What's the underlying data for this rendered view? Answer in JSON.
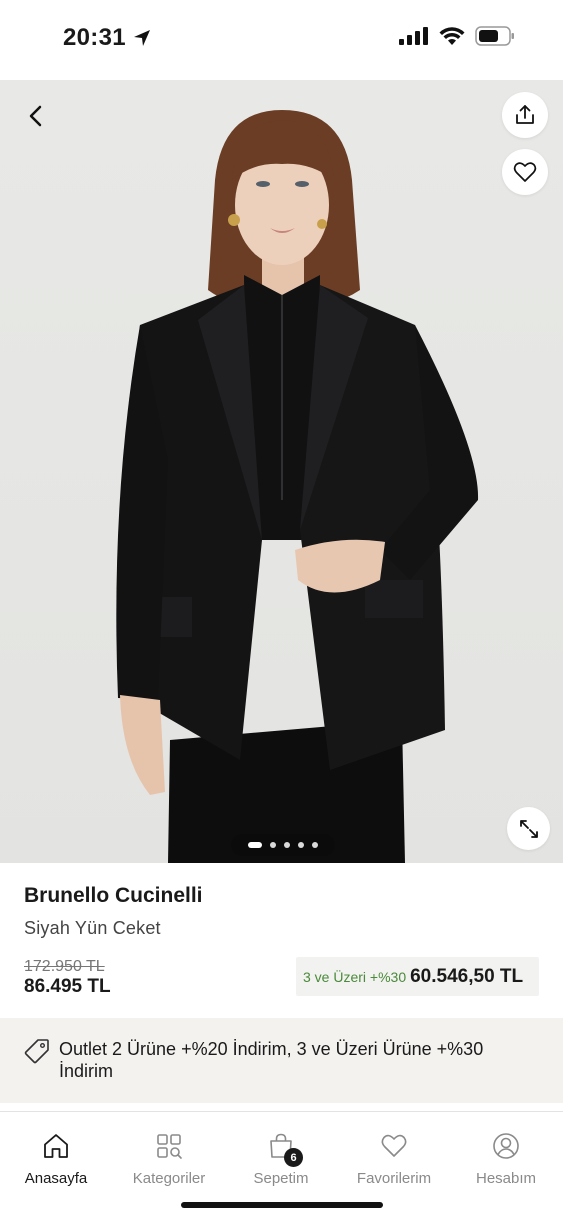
{
  "status_bar": {
    "time": "20:31",
    "icons": [
      "location-arrow-icon",
      "cellular-signal-icon",
      "wifi-icon",
      "battery-icon"
    ]
  },
  "hero": {
    "icons": [
      "back-arrow-icon",
      "share-icon",
      "heart-icon",
      "expand-icon"
    ],
    "image_count": 5,
    "active_image_index": 0
  },
  "product": {
    "brand": "Brunello Cucinelli",
    "name": "Siyah Yün Ceket",
    "old_price": "172.950 TL",
    "price": "86.495 TL",
    "promo_label": "3 ve Üzeri +%30",
    "promo_price": "60.546,50 TL"
  },
  "campaign": {
    "icon": "price-tag-icon",
    "text": "Outlet 2 Ürüne +%20 İndirim, 3 ve Üzeri Ürüne +%30 İndirim"
  },
  "nav": {
    "items": [
      {
        "label": "Anasayfa",
        "icon": "home-icon",
        "active": true
      },
      {
        "label": "Kategoriler",
        "icon": "categories-icon",
        "active": false
      },
      {
        "label": "Sepetim",
        "icon": "shopping-bag-icon",
        "active": false,
        "badge": "6"
      },
      {
        "label": "Favorilerim",
        "icon": "heart-icon",
        "active": false
      },
      {
        "label": "Hesabım",
        "icon": "account-icon",
        "active": false
      }
    ]
  },
  "colors": {
    "accent_green": "#4a8a3a",
    "text_dark": "#1a1a1a",
    "hero_background": "#e7e8e5",
    "banner_background": "#f3f2ef"
  }
}
